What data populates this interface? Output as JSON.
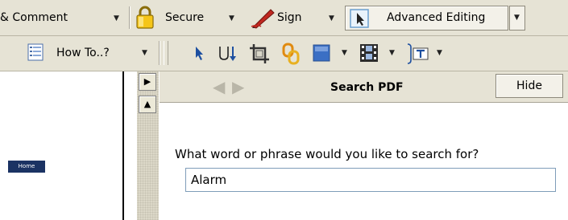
{
  "toolbar_top": {
    "comment_label": "& Comment",
    "secure_label": "Secure",
    "sign_label": "Sign",
    "advanced_editing_label": "Advanced Editing"
  },
  "toolbar_second": {
    "howto_label": "How To..?"
  },
  "document": {
    "home_label": "Home"
  },
  "search_panel": {
    "title": "Search PDF",
    "hide_label": "Hide",
    "prompt": "What word or phrase would you like to search for?",
    "query_value": "Alarm"
  },
  "colors": {
    "toolbar_bg": "#e6e3d5",
    "lock_yellow": "#f5c518",
    "pen_red": "#c02820",
    "home_chip": "#1b3363"
  }
}
